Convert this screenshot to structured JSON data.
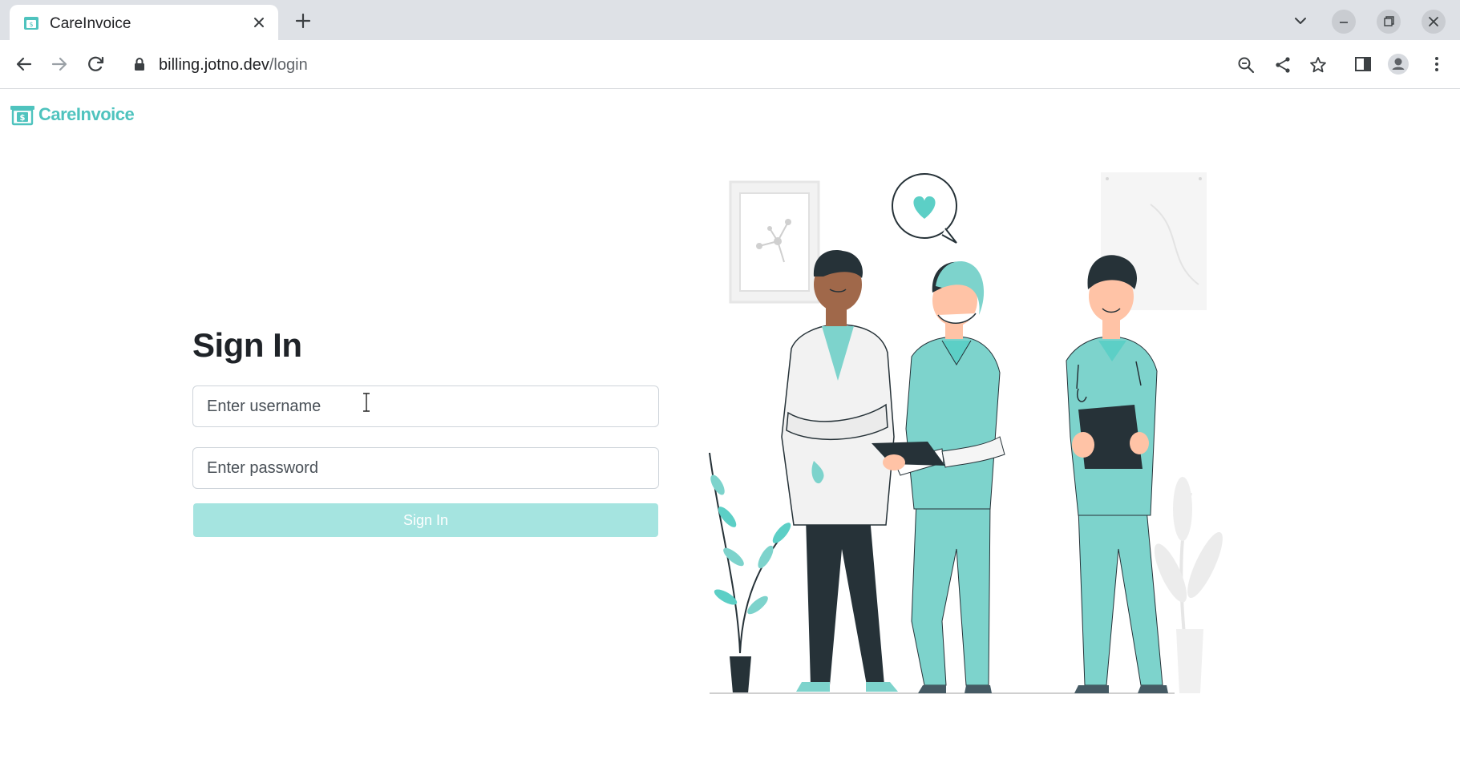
{
  "browser": {
    "tab_title": "CareInvoice",
    "url_host": "billing.jotno.dev",
    "url_path": "/login",
    "icons": [
      "close-icon",
      "plus-icon",
      "chevron-down-icon",
      "minimize-icon",
      "restore-icon",
      "close-icon",
      "back-arrow-icon",
      "forward-arrow-icon",
      "reload-icon",
      "lock-icon",
      "zoom-out-icon",
      "share-icon",
      "star-icon",
      "side-panel-icon",
      "profile-icon",
      "kebab-menu-icon"
    ]
  },
  "brand": {
    "name": "CareInvoice",
    "color": "#4fc3be"
  },
  "login": {
    "title": "Sign In",
    "username_placeholder": "Enter username",
    "password_placeholder": "Enter password",
    "button_label": "Sign In",
    "button_color": "#a5e4e0"
  },
  "colors": {
    "accent": "#7dd3cc",
    "dark": "#263238"
  }
}
